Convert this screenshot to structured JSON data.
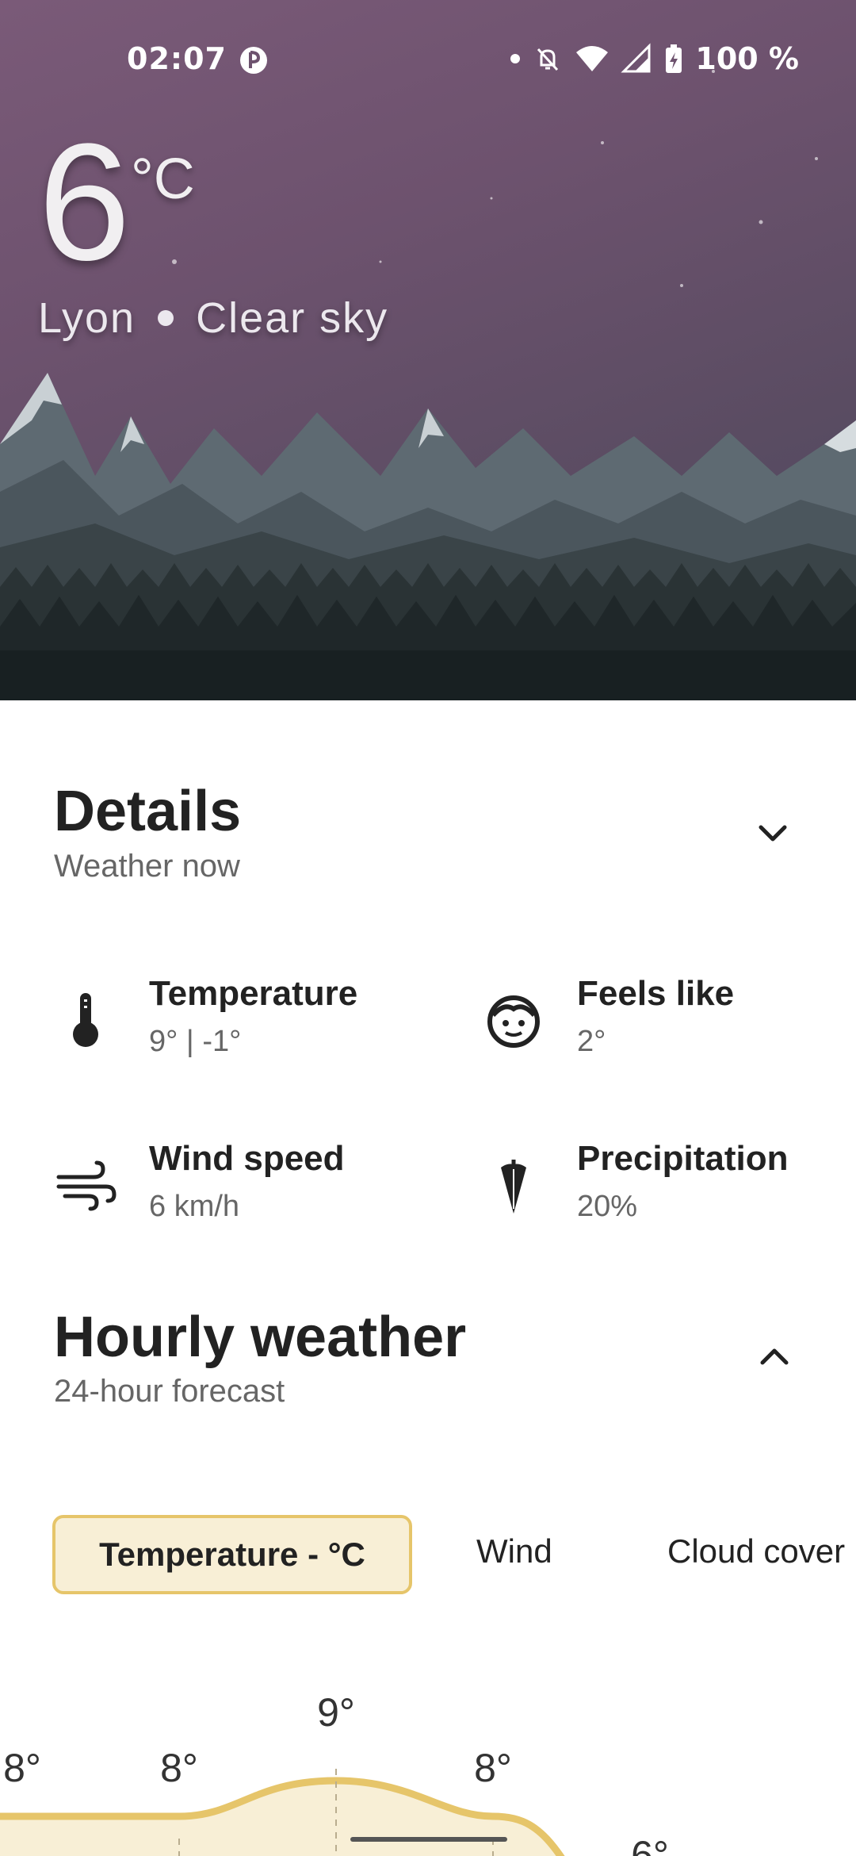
{
  "status_bar": {
    "time": "02:07",
    "battery": "100 %"
  },
  "hero": {
    "temperature": "6",
    "unit": "°C",
    "city": "Lyon",
    "condition": "Clear sky"
  },
  "details": {
    "title": "Details",
    "subtitle": "Weather now",
    "items": [
      {
        "label": "Temperature",
        "value": "9°  |  -1°",
        "icon": "thermometer-icon"
      },
      {
        "label": "Feels like",
        "value": "2°",
        "icon": "face-icon"
      },
      {
        "label": "Wind speed",
        "value": "6 km/h",
        "icon": "wind-icon"
      },
      {
        "label": "Precipitation",
        "value": "20%",
        "icon": "umbrella-icon"
      }
    ]
  },
  "hourly": {
    "title": "Hourly weather",
    "subtitle": "24-hour forecast",
    "tabs": [
      "Temperature  -  °C",
      "Wind",
      "Cloud cover"
    ]
  },
  "chart_data": {
    "type": "area",
    "labels": [
      "8°",
      "8°",
      "9°",
      "8°",
      "6°"
    ],
    "values": [
      8,
      8,
      9,
      8,
      6
    ],
    "fill_color": "#f8efd6",
    "line_color": "#e6c56a"
  },
  "colors": {
    "accent": "#e6c56a",
    "accent_bg": "#f8efd6"
  }
}
